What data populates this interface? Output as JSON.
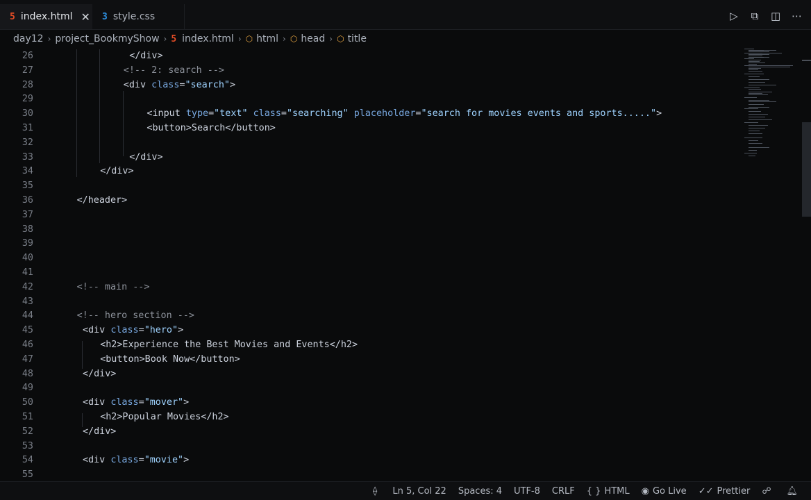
{
  "tabs": [
    {
      "label": "index.html",
      "icon": "html5-icon",
      "icon_glyph": "5",
      "icon_color": "#e44d26",
      "active": true,
      "close": "✕"
    },
    {
      "label": "style.css",
      "icon": "css3-icon",
      "icon_glyph": "3",
      "icon_color": "#2d8fe0",
      "active": false
    }
  ],
  "breadcrumb": {
    "folder1": "day12",
    "folder2": "project_BookmyShow",
    "file": "index.html",
    "sym1": "html",
    "sym2": "head",
    "sym3": "title"
  },
  "colors": {
    "background": "#0a0b0c",
    "html_icon": "#e44d26",
    "css_icon": "#2d8fe0",
    "attribute": "#78a8e0",
    "string": "#9fd3ff"
  },
  "code_lines": [
    {
      "n": "26",
      "parts": [
        [
          "t",
          "</div>"
        ]
      ],
      "indent": 13
    },
    {
      "n": "27",
      "parts": [
        [
          "c",
          "<!-- 2: search -->"
        ]
      ],
      "indent": 12
    },
    {
      "n": "28",
      "parts": [
        [
          "t",
          "<div "
        ],
        [
          "a",
          "class"
        ],
        [
          "t",
          "="
        ],
        [
          "s",
          "\"search\""
        ],
        [
          "t",
          ">"
        ]
      ],
      "indent": 12
    },
    {
      "n": "29",
      "parts": [],
      "indent": 0
    },
    {
      "n": "30",
      "parts": [
        [
          "t",
          "<input "
        ],
        [
          "a",
          "type"
        ],
        [
          "t",
          "="
        ],
        [
          "s",
          "\"text\""
        ],
        [
          "t",
          " "
        ],
        [
          "a",
          "class"
        ],
        [
          "t",
          "="
        ],
        [
          "s",
          "\"searching\""
        ],
        [
          "t",
          " "
        ],
        [
          "a",
          "placeholder"
        ],
        [
          "t",
          "="
        ],
        [
          "s",
          "\"search for movies events and sports.....\""
        ],
        [
          "t",
          ">"
        ]
      ],
      "indent": 16
    },
    {
      "n": "31",
      "parts": [
        [
          "t",
          "<button>Search</button>"
        ]
      ],
      "indent": 16
    },
    {
      "n": "32",
      "parts": [],
      "indent": 0
    },
    {
      "n": "33",
      "parts": [
        [
          "t",
          "</div>"
        ]
      ],
      "indent": 13
    },
    {
      "n": "34",
      "parts": [
        [
          "t",
          "</div>"
        ]
      ],
      "indent": 8
    },
    {
      "n": "35",
      "parts": [],
      "indent": 0
    },
    {
      "n": "36",
      "parts": [
        [
          "t",
          "</header>"
        ]
      ],
      "indent": 4
    },
    {
      "n": "37",
      "parts": [],
      "indent": 0
    },
    {
      "n": "38",
      "parts": [],
      "indent": 0
    },
    {
      "n": "39",
      "parts": [],
      "indent": 0
    },
    {
      "n": "40",
      "parts": [],
      "indent": 0
    },
    {
      "n": "41",
      "parts": [],
      "indent": 0
    },
    {
      "n": "42",
      "parts": [
        [
          "c",
          "<!-- main -->"
        ]
      ],
      "indent": 4
    },
    {
      "n": "43",
      "parts": [],
      "indent": 0
    },
    {
      "n": "44",
      "parts": [
        [
          "c",
          "<!-- hero section -->"
        ]
      ],
      "indent": 4
    },
    {
      "n": "45",
      "parts": [
        [
          "t",
          "<div "
        ],
        [
          "a",
          "class"
        ],
        [
          "t",
          "="
        ],
        [
          "s",
          "\"hero\""
        ],
        [
          "t",
          ">"
        ]
      ],
      "indent": 5
    },
    {
      "n": "46",
      "parts": [
        [
          "t",
          "<h2>Experience the Best Movies and Events</h2>"
        ]
      ],
      "indent": 8
    },
    {
      "n": "47",
      "parts": [
        [
          "t",
          "<button>Book Now</button>"
        ]
      ],
      "indent": 8
    },
    {
      "n": "48",
      "parts": [
        [
          "t",
          "</div>"
        ]
      ],
      "indent": 5
    },
    {
      "n": "49",
      "parts": [],
      "indent": 0
    },
    {
      "n": "50",
      "parts": [
        [
          "t",
          "<div "
        ],
        [
          "a",
          "class"
        ],
        [
          "t",
          "="
        ],
        [
          "s",
          "\"mover\""
        ],
        [
          "t",
          ">"
        ]
      ],
      "indent": 5
    },
    {
      "n": "51",
      "parts": [
        [
          "t",
          "<h2>Popular Movies</h2>"
        ]
      ],
      "indent": 8
    },
    {
      "n": "52",
      "parts": [
        [
          "t",
          "</div>"
        ]
      ],
      "indent": 5
    },
    {
      "n": "53",
      "parts": [],
      "indent": 0
    },
    {
      "n": "54",
      "parts": [
        [
          "t",
          "<div "
        ],
        [
          "a",
          "class"
        ],
        [
          "t",
          "="
        ],
        [
          "s",
          "\"movie\""
        ],
        [
          "t",
          ">"
        ]
      ],
      "indent": 5
    },
    {
      "n": "55",
      "parts": [],
      "indent": 0
    }
  ],
  "top_actions": [
    {
      "name": "run-icon",
      "glyph": "▷"
    },
    {
      "name": "open-preview-icon",
      "glyph": "⧉"
    },
    {
      "name": "split-editor-icon",
      "glyph": "◫"
    },
    {
      "name": "more-actions-icon",
      "glyph": "⋯"
    }
  ],
  "status": {
    "sync_icon": "⟠",
    "position": "Ln 5, Col 22",
    "spaces": "Spaces: 4",
    "encoding": "UTF-8",
    "eol": "CRLF",
    "lang_icon": "{ }",
    "language": "HTML",
    "golive_icon": "◉",
    "golive": "Go Live",
    "prettier_icon": "✓✓",
    "prettier": "Prettier",
    "feedback_icon": "☍",
    "bell_icon": "🔔"
  }
}
